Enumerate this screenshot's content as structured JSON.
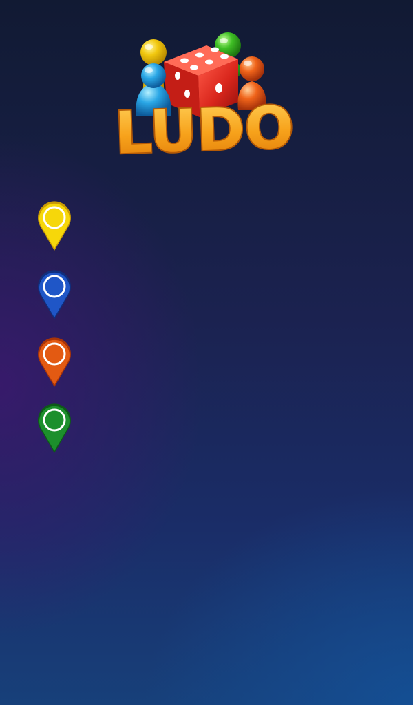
{
  "logo": {
    "title": "LUDO",
    "title_color": "#f7a21b",
    "die_color": "#d9261c",
    "token_colors": [
      "#f2c80f",
      "#2aa7e6",
      "#3fbf25",
      "#f0641a"
    ]
  },
  "player_pins": [
    {
      "color_name": "yellow",
      "color": "#f6d70a",
      "shade": "#c99a04"
    },
    {
      "color_name": "blue",
      "color": "#1f56c7",
      "shade": "#0f2f7d"
    },
    {
      "color_name": "orange",
      "color": "#e35a12",
      "shade": "#a83408"
    },
    {
      "color_name": "green",
      "color": "#1c8f2c",
      "shade": "#0d5a18"
    }
  ]
}
